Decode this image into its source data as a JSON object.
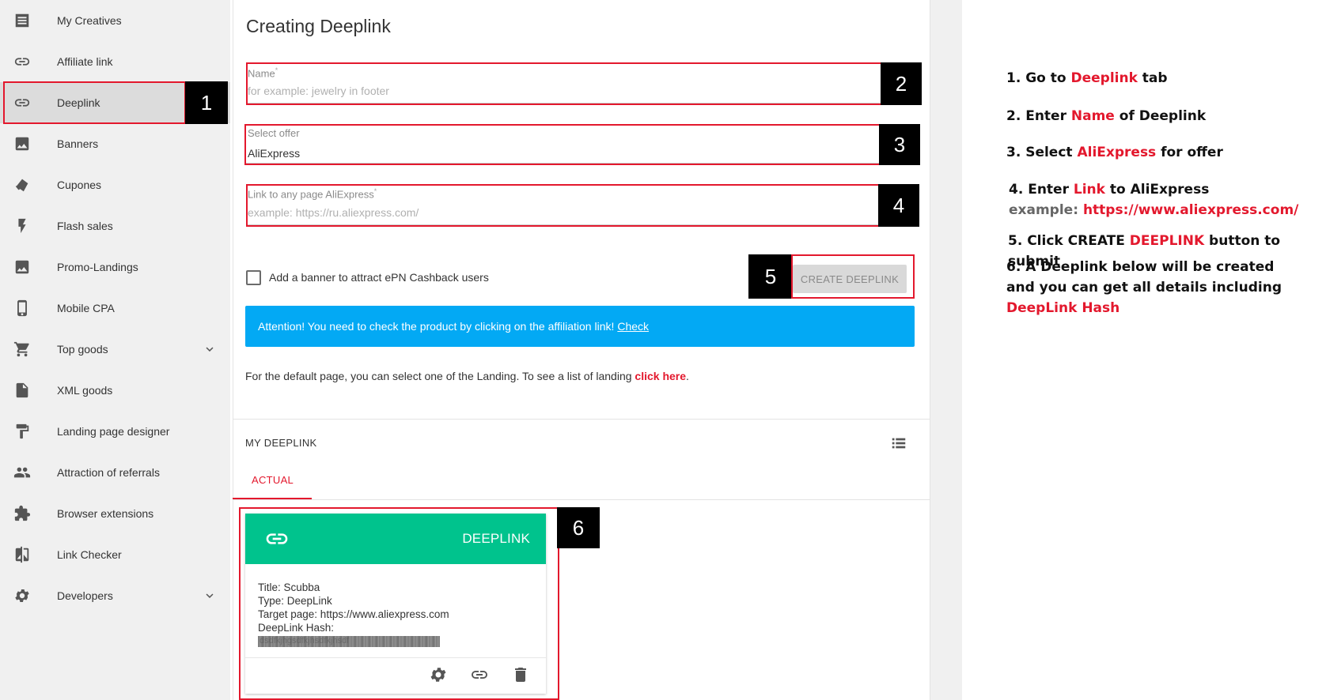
{
  "sidebar": {
    "items": [
      {
        "label": "My Creatives",
        "icon": "list-doc-icon"
      },
      {
        "label": "Affiliate link",
        "icon": "link-icon"
      },
      {
        "label": "Deeplink",
        "icon": "link-icon",
        "active": true
      },
      {
        "label": "Banners",
        "icon": "image-icon"
      },
      {
        "label": "Cupones",
        "icon": "coupon-icon"
      },
      {
        "label": "Flash sales",
        "icon": "flash-icon"
      },
      {
        "label": "Promo-Landings",
        "icon": "image-icon"
      },
      {
        "label": "Mobile CPA",
        "icon": "phone-icon"
      },
      {
        "label": "Top goods",
        "icon": "cart-icon",
        "expandable": true
      },
      {
        "label": "XML goods",
        "icon": "file-icon"
      },
      {
        "label": "Landing page designer",
        "icon": "paint-roller-icon"
      },
      {
        "label": "Attraction of referrals",
        "icon": "people-icon"
      },
      {
        "label": "Browser extensions",
        "icon": "puzzle-icon"
      },
      {
        "label": "Link Checker",
        "icon": "compare-icon"
      },
      {
        "label": "Developers",
        "icon": "gear-icon",
        "expandable": true
      }
    ]
  },
  "form": {
    "title": "Creating Deeplink",
    "name_label": "Name",
    "name_placeholder": "for example: jewelry in footer",
    "offer_label": "Select offer",
    "offer_value": "AliExpress",
    "link_label": "Link to any page AliExpress",
    "link_placeholder": "example: https://ru.aliexpress.com/",
    "required_mark": "*",
    "checkbox_label": "Add a banner to attract ePN Cashback users",
    "create_button": "CREATE DEEPLINK",
    "alert_text": "Attention! You need to check the product by clicking on the affiliation link!",
    "alert_link": "Check",
    "info_text": "For the default page, you can select one of the Landing. To see a list of landing",
    "info_link": "click here",
    "info_end": "."
  },
  "list": {
    "heading": "MY DEEPLINK",
    "tab_actual": "ACTUAL"
  },
  "card": {
    "header": "DEEPLINK",
    "title_line": "Title: Scubba",
    "type_line": "Type: DeepLink",
    "target_line": "Target page: https://www.aliexpress.com",
    "hash_label": "DeepLink Hash:",
    "hash_value": "dsdfkjhgsdfkjhsdfkjhsdf"
  },
  "markers": [
    "1",
    "2",
    "3",
    "4",
    "5",
    "6"
  ],
  "instructions": {
    "s1": {
      "a": "1. Go to ",
      "b": "Deeplink",
      "c": " tab"
    },
    "s2": {
      "a": "2. Enter ",
      "b": "Name",
      "c": " of Deeplink"
    },
    "s3": {
      "a": "3. Select ",
      "b": "AliExpress",
      "c": " for offer"
    },
    "s4": {
      "a": "4. Enter ",
      "b": "Link",
      "c": " to AliExpress",
      "d": "example: ",
      "e": "https://www.aliexpress.com/"
    },
    "s5": {
      "a": "5. Click CREATE ",
      "b": "DEEPLINK",
      "c": " button to submit"
    },
    "s6": {
      "a": "6. A Deeplink below will be created and you can get all details including ",
      "b": "DeepLink Hash"
    }
  },
  "colors": {
    "accent_red": "#e3182d",
    "alert_blue": "#03a9f4",
    "card_green": "#00c38d"
  }
}
